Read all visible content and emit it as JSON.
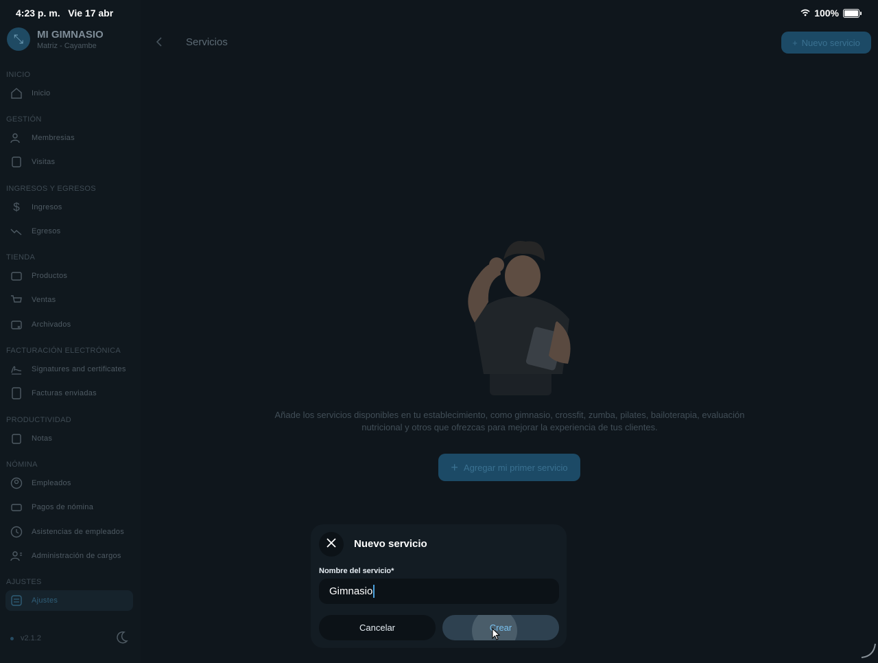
{
  "status_bar": {
    "time": "4:23 p. m.",
    "date": "Vie 17 abr",
    "battery": "100%"
  },
  "brand": {
    "name": "MI GIMNASIO",
    "subtitle": "Matriz - Cayambe",
    "icon": "dumbbell-icon"
  },
  "sidebar": {
    "sections": [
      {
        "title": "INICIO",
        "items": [
          {
            "label": "Inicio",
            "icon": "home-icon"
          }
        ]
      },
      {
        "title": "GESTIÓN",
        "items": [
          {
            "label": "Membresias",
            "icon": "users-icon"
          },
          {
            "label": "Visitas",
            "icon": "visits-icon"
          }
        ]
      },
      {
        "title": "INGRESOS Y EGRESOS",
        "items": [
          {
            "label": "Ingresos",
            "icon": "dollar-icon"
          },
          {
            "label": "Egresos",
            "icon": "trend-down-icon"
          }
        ]
      },
      {
        "title": "TIENDA",
        "items": [
          {
            "label": "Productos",
            "icon": "store-icon"
          },
          {
            "label": "Ventas",
            "icon": "cart-icon"
          },
          {
            "label": "Archivados",
            "icon": "archive-icon"
          }
        ]
      },
      {
        "title": "FACTURACIÓN ELECTRÓNICA",
        "items": [
          {
            "label": "Signatures and certificates",
            "icon": "signature-icon"
          },
          {
            "label": "Facturas enviadas",
            "icon": "invoice-icon"
          }
        ]
      },
      {
        "title": "PRODUCTIVIDAD",
        "items": [
          {
            "label": "Notas",
            "icon": "notes-icon"
          }
        ]
      },
      {
        "title": "NÓMINA",
        "items": [
          {
            "label": "Empleados",
            "icon": "user-circle-icon"
          },
          {
            "label": "Pagos de nómina",
            "icon": "payroll-icon"
          },
          {
            "label": "Asistencias de empleados",
            "icon": "clock-icon"
          },
          {
            "label": "Administración de cargos",
            "icon": "user-roles-icon"
          }
        ]
      },
      {
        "title": "AJUSTES",
        "items": [
          {
            "label": "Ajustes",
            "icon": "settings-icon",
            "active": true
          }
        ]
      }
    ],
    "version": "v2.1.2"
  },
  "header": {
    "title": "Servicios",
    "new_button": "Nuevo servicio"
  },
  "empty_state": {
    "description": "Añade los servicios disponibles en tu establecimiento, como gimnasio, crossfit, zumba, pilates, bailoterapia, evaluación nutricional y otros que ofrezcas para mejorar la experiencia de tus clientes.",
    "button": "Agregar mi primer servicio"
  },
  "dialog": {
    "title": "Nuevo servicio",
    "field_label": "Nombre del servicio*",
    "field_value": "Gimnasio",
    "cancel": "Cancelar",
    "create": "Crear"
  },
  "colors": {
    "accent": "#1c4a66",
    "accent_text": "#79c2f0",
    "background": "#0f161c"
  }
}
